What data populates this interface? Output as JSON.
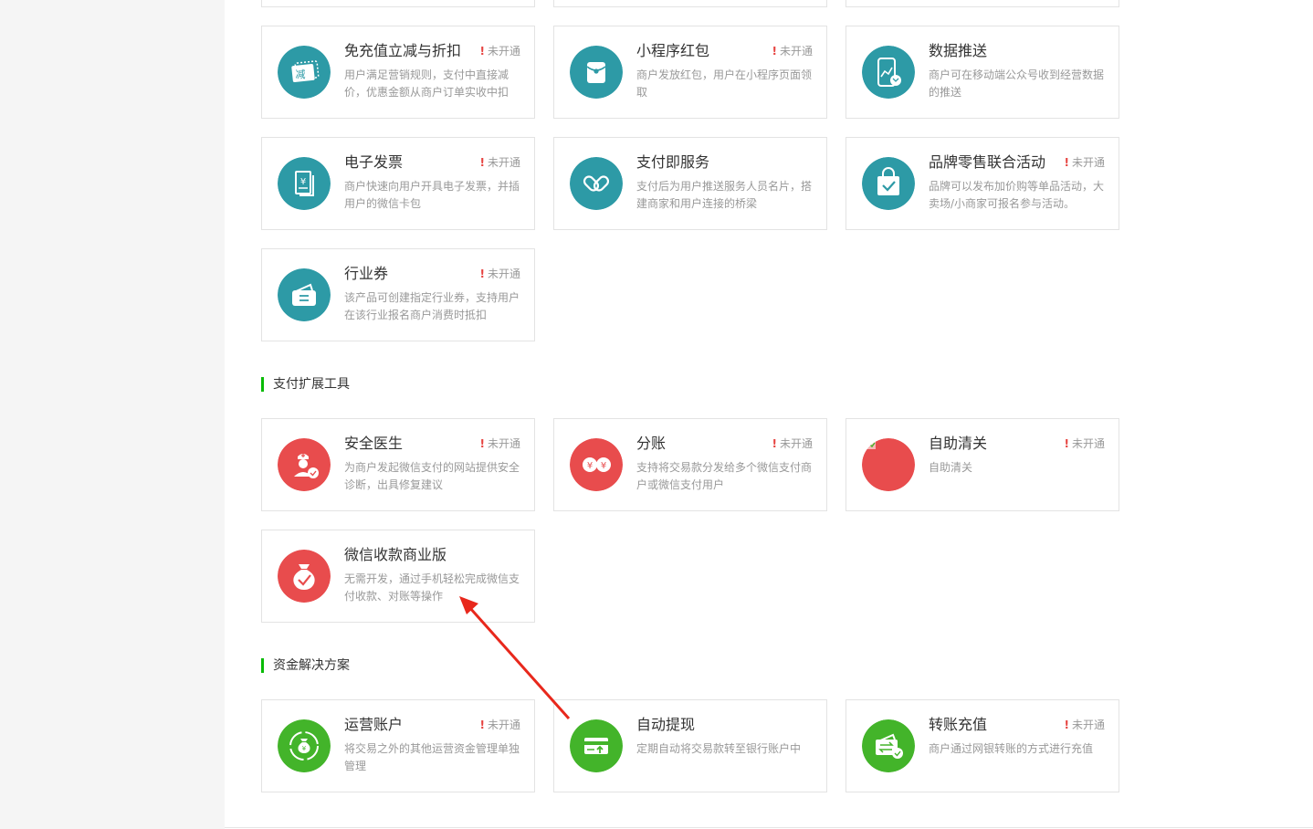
{
  "status_label": "未开通",
  "status_mark": "!",
  "colors": {
    "teal": "#2d9aa6",
    "red": "#e84c4d",
    "green": "#43b42a",
    "accent": "#09bb07",
    "arrow": "#e8281c"
  },
  "marketing": {
    "items": [
      {
        "title": "免充值立减与折扣",
        "desc": "用户满足营销规则，支付中直接减价，优惠金额从商户订单实收中扣",
        "status": "未开通",
        "icon_text": "减"
      },
      {
        "title": "小程序红包",
        "desc": "商户发放红包，用户在小程序页面领取",
        "status": "未开通"
      },
      {
        "title": "数据推送",
        "desc": "商户可在移动端公众号收到经营数据的推送",
        "status": ""
      },
      {
        "title": "电子发票",
        "desc": "商户快速向用户开具电子发票，并插用户的微信卡包",
        "status": "未开通",
        "icon_text": "¥"
      },
      {
        "title": "支付即服务",
        "desc": "支付后为用户推送服务人员名片，搭建商家和用户连接的桥梁",
        "status": ""
      },
      {
        "title": "品牌零售联合活动",
        "desc": "品牌可以发布加价购等单品活动，大卖场/小商家可报名参与活动。",
        "status": "未开通"
      },
      {
        "title": "行业券",
        "desc": "该产品可创建指定行业券，支持用户在该行业报名商户消费时抵扣",
        "status": "未开通"
      }
    ]
  },
  "ext_tools": {
    "heading": "支付扩展工具",
    "items": [
      {
        "title": "安全医生",
        "desc": "为商户发起微信支付的网站提供安全诊断，出具修复建议",
        "status": "未开通"
      },
      {
        "title": "分账",
        "desc": "支持将交易款分发给多个微信支付商户或微信支付用户",
        "status": "未开通",
        "icon_text": "¥"
      },
      {
        "title": "自助清关",
        "desc": "自助清关",
        "status": "未开通"
      },
      {
        "title": "微信收款商业版",
        "desc": "无需开发，通过手机轻松完成微信支付收款、对账等操作",
        "status": ""
      }
    ]
  },
  "funds": {
    "heading": "资金解决方案",
    "items": [
      {
        "title": "运营账户",
        "desc": "将交易之外的其他运营资金管理单独管理",
        "status": "未开通",
        "icon_text": "¥"
      },
      {
        "title": "自动提现",
        "desc": "定期自动将交易款转至银行账户中",
        "status": ""
      },
      {
        "title": "转账充值",
        "desc": "商户通过网银转账的方式进行充值",
        "status": "未开通"
      }
    ]
  }
}
